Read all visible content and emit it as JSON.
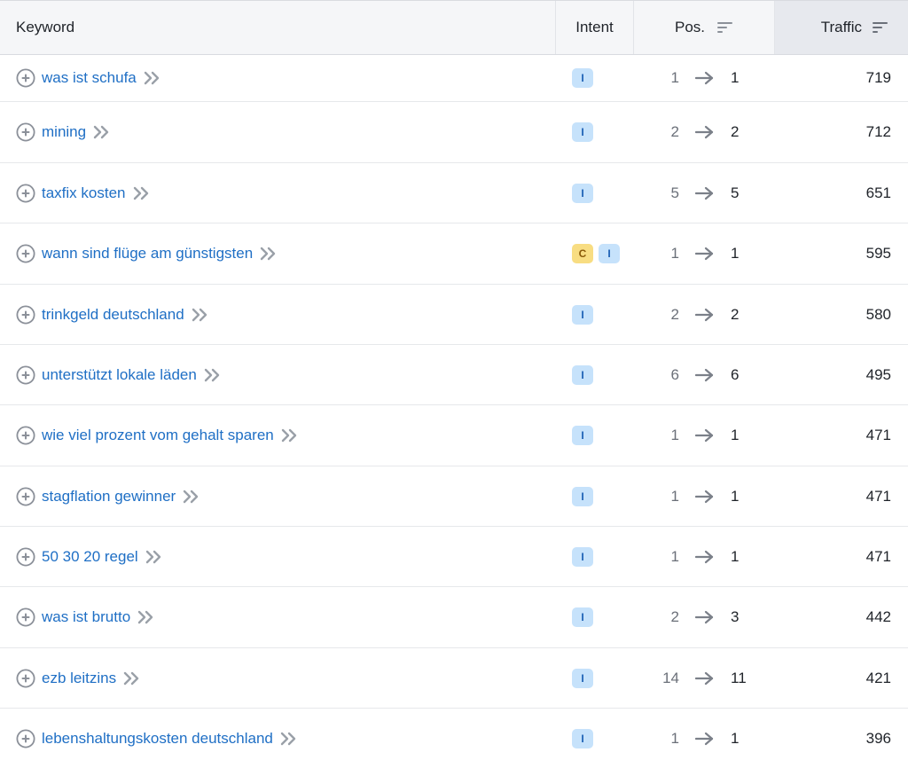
{
  "header": {
    "keyword": "Keyword",
    "intent": "Intent",
    "pos": "Pos.",
    "traffic": "Traffic"
  },
  "rows": [
    {
      "keyword": "was ist schufa",
      "intents": [
        "I"
      ],
      "pos_from": "1",
      "pos_to": "1",
      "traffic": "719"
    },
    {
      "keyword": "mining",
      "intents": [
        "I"
      ],
      "pos_from": "2",
      "pos_to": "2",
      "traffic": "712"
    },
    {
      "keyword": "taxfix kosten",
      "intents": [
        "I"
      ],
      "pos_from": "5",
      "pos_to": "5",
      "traffic": "651"
    },
    {
      "keyword": "wann sind flüge am günstigsten",
      "intents": [
        "C",
        "I"
      ],
      "pos_from": "1",
      "pos_to": "1",
      "traffic": "595"
    },
    {
      "keyword": "trinkgeld deutschland",
      "intents": [
        "I"
      ],
      "pos_from": "2",
      "pos_to": "2",
      "traffic": "580"
    },
    {
      "keyword": "unterstützt lokale läden",
      "intents": [
        "I"
      ],
      "pos_from": "6",
      "pos_to": "6",
      "traffic": "495"
    },
    {
      "keyword": "wie viel prozent vom gehalt sparen",
      "intents": [
        "I"
      ],
      "pos_from": "1",
      "pos_to": "1",
      "traffic": "471"
    },
    {
      "keyword": "stagflation gewinner",
      "intents": [
        "I"
      ],
      "pos_from": "1",
      "pos_to": "1",
      "traffic": "471"
    },
    {
      "keyword": "50 30 20 regel",
      "intents": [
        "I"
      ],
      "pos_from": "1",
      "pos_to": "1",
      "traffic": "471"
    },
    {
      "keyword": "was ist brutto",
      "intents": [
        "I"
      ],
      "pos_from": "2",
      "pos_to": "3",
      "traffic": "442"
    },
    {
      "keyword": "ezb leitzins",
      "intents": [
        "I"
      ],
      "pos_from": "14",
      "pos_to": "11",
      "traffic": "421"
    },
    {
      "keyword": "lebenshaltungskosten deutschland",
      "intents": [
        "I"
      ],
      "pos_from": "1",
      "pos_to": "1",
      "traffic": "396"
    }
  ],
  "icons": {
    "add": "plus-circle-icon",
    "expand": "double-chevron-right-icon",
    "sort": "sort-lines-icon",
    "arrow": "arrow-right-icon"
  },
  "colors": {
    "link": "#1f6fc5",
    "intent_informational": "#c6e2fb",
    "intent_commercial": "#f8dd82",
    "header_bg": "#f5f6f8",
    "sorted_col_bg": "#e7e9ee"
  }
}
